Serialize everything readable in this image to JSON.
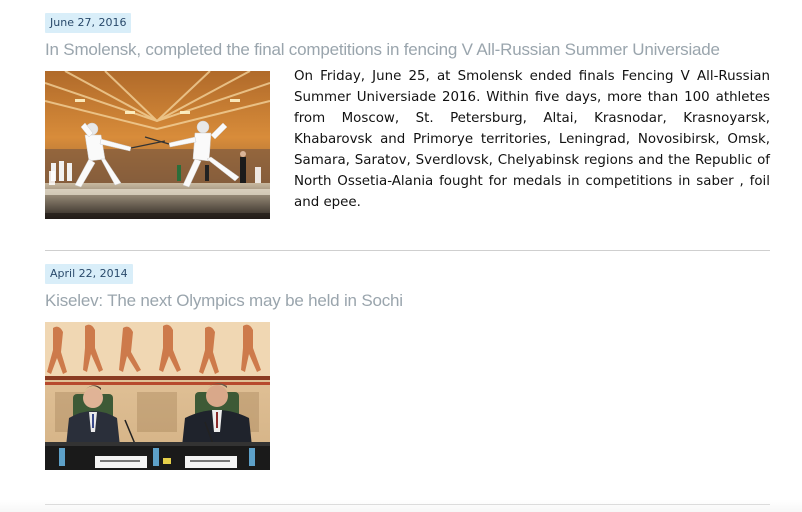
{
  "articles": [
    {
      "date": "June 27, 2016",
      "title": "In Smolensk, completed the final competitions in fencing V All-Russian Summer Universiade",
      "summary": "On Friday, June 25, at Smolensk ended finals Fencing V All-Russian Summer Universiade 2016. Within five days, more than 100 athletes from Moscow, St. Petersburg, Altai, Krasnodar, Krasnoyarsk, Khabarovsk and Primorye territories, Leningrad, Novosibirsk, Omsk, Samara, Saratov, Sverdlovsk, Chelyabinsk regions and the Republic of North Ossetia-Alania fought for medals in competitions in saber , foil and epee.",
      "image": "fencing-photo"
    },
    {
      "date": "April 22, 2014",
      "title": "Kiselev: The next Olympics may be held in Sochi",
      "summary": "",
      "image": "press-conference-photo"
    }
  ],
  "colors": {
    "date_badge_bg": "#d9eef9",
    "date_text": "#2a4a6b",
    "title_text": "#9aa5ad",
    "body_text": "#111111",
    "divider": "#cfcfcf"
  }
}
